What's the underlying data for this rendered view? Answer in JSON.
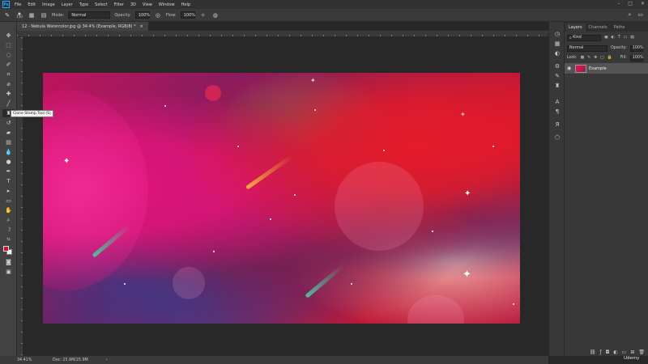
{
  "menubar": {
    "logo": "Ps",
    "items": [
      "File",
      "Edit",
      "Image",
      "Layer",
      "Type",
      "Select",
      "Filter",
      "3D",
      "View",
      "Window",
      "Help"
    ]
  },
  "options": {
    "brush_size": "150",
    "mode_label": "Mode:",
    "mode_value": "Normal",
    "opacity_label": "Opacity:",
    "opacity_value": "100%",
    "flow_label": "Flow:",
    "flow_value": "100%"
  },
  "document": {
    "tab_title": "12 - Nebula Watercolor.jpg @ 34.4% (Example, RGB/8) *",
    "close": "×"
  },
  "tooltip": "Clone Stamp Tool (S)",
  "panels": {
    "tabs": [
      "Layers",
      "Channels",
      "Paths"
    ],
    "kind_label": "Kind",
    "blend_mode": "Normal",
    "opacity_label": "Opacity:",
    "opacity_value": "100%",
    "lock_label": "Lock:",
    "fill_label": "Fill:",
    "fill_value": "100%",
    "layer_name": "Example"
  },
  "status": {
    "zoom": "34.41%",
    "doc_info": "Doc: 25.9M/25.9M"
  },
  "watermark": "Udemy",
  "colors": {
    "foreground": "#d8102a",
    "background": "#ffffff",
    "accent": "#31a8ff"
  }
}
